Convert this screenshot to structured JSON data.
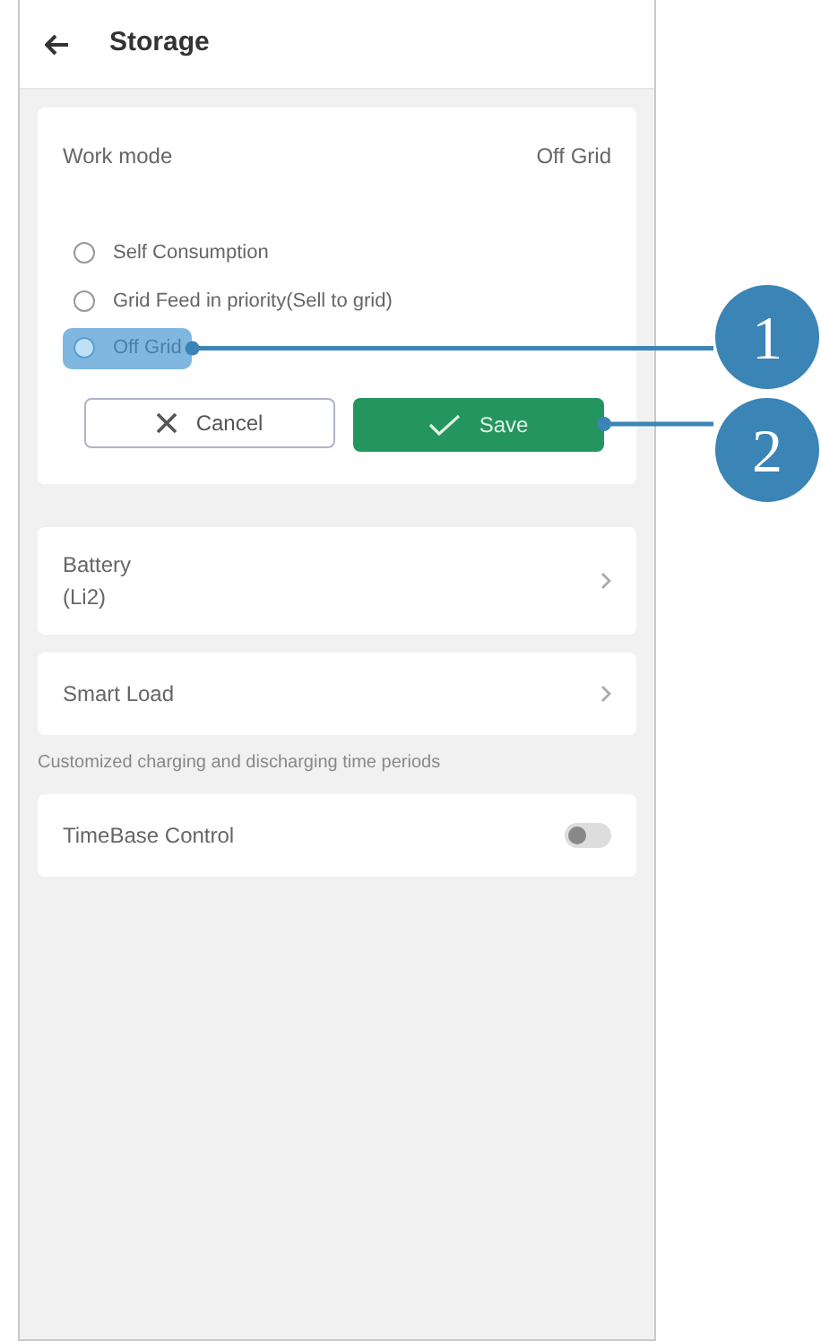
{
  "header": {
    "title": "Storage"
  },
  "work_mode": {
    "label": "Work mode",
    "value": "Off Grid",
    "options": [
      {
        "label": "Self Consumption",
        "selected": false,
        "highlighted": false
      },
      {
        "label": "Grid Feed in priority(Sell to grid)",
        "selected": false,
        "highlighted": false
      },
      {
        "label": "Off Grid",
        "selected": true,
        "highlighted": true,
        "callout": "1"
      }
    ],
    "buttons": [
      {
        "kind": "cancel",
        "label": "Cancel"
      },
      {
        "kind": "save",
        "label": "Save",
        "callout": "2"
      }
    ]
  },
  "rows": [
    {
      "kind": "link",
      "label": "Battery",
      "sublabel": "(Li2)"
    },
    {
      "kind": "link",
      "label": "Smart Load"
    },
    {
      "kind": "note",
      "label": "Customized charging and discharging time periods"
    },
    {
      "kind": "toggle",
      "label": "TimeBase Control",
      "on": false
    }
  ]
}
